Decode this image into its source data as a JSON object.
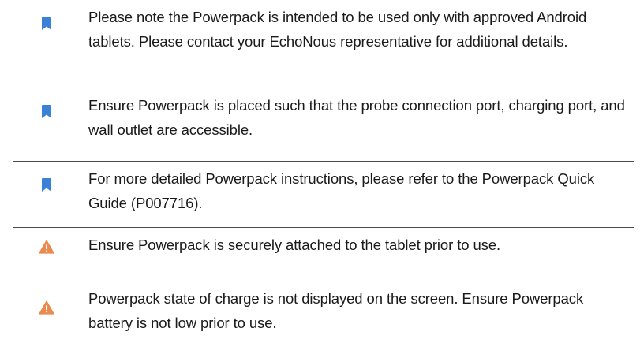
{
  "colors": {
    "note_icon": "#3b82d6",
    "warning_icon": "#ea8a4e",
    "border": "#4a4a4a"
  },
  "rows": [
    {
      "icon": "bookmark-icon",
      "text": "Please note the Powerpack is intended to be used only with approved Android tablets. Please contact your EchoNous representative for additional details."
    },
    {
      "icon": "bookmark-icon",
      "text": "Ensure Powerpack is placed such that the probe connection port, charging port, and wall outlet are accessible."
    },
    {
      "icon": "bookmark-icon",
      "text": "For more detailed Powerpack instructions, please refer to the Powerpack Quick Guide (P007716)."
    },
    {
      "icon": "warning-icon",
      "text": "Ensure Powerpack is securely attached to the tablet prior to use."
    },
    {
      "icon": "warning-icon",
      "text": "Powerpack state of charge is not displayed on the screen. Ensure Powerpack battery is not low prior to use."
    }
  ]
}
